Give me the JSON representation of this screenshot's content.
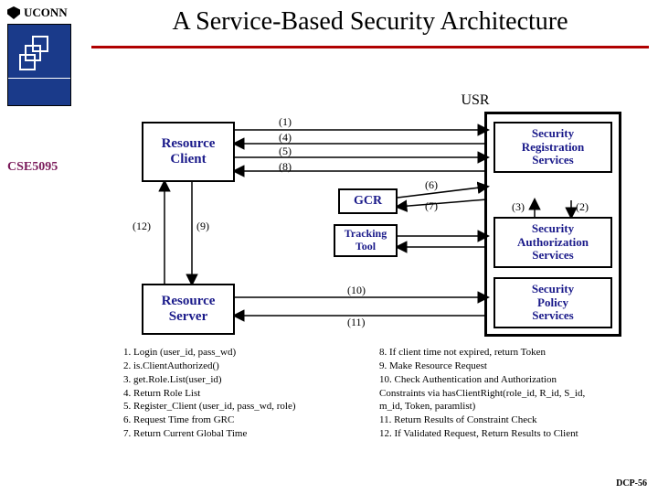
{
  "header": {
    "org": "UCONN",
    "title": "A Service-Based Security Architecture",
    "course": "CSE5095"
  },
  "boxes": {
    "usr": "USR",
    "resource_client": "Resource\nClient",
    "gcr": "GCR",
    "tracking_tool": "Tracking\nTool",
    "resource_server": "Resource\nServer",
    "sec_reg": "Security\nRegistration\nServices",
    "sec_auth": "Security\nAuthorization\nServices",
    "sec_policy": "Security\nPolicy\nServices"
  },
  "edges": {
    "e1": "(1)",
    "e2": "(2)",
    "e3": "(3)",
    "e4": "(4)",
    "e5": "(5)",
    "e6": "(6)",
    "e7": "(7)",
    "e8": "(8)",
    "e9": "(9)",
    "e10": "(10)",
    "e11": "(11)",
    "e12": "(12)"
  },
  "legend_left": [
    "1.  Login (user_id, pass_wd)",
    "2.  is.ClientAuthorized()",
    "3.  get.Role.List(user_id)",
    "4.  Return Role List",
    "5.  Register_Client (user_id, pass_wd, role)",
    "6.  Request Time from GRC",
    "7.  Return Current Global Time"
  ],
  "legend_right": [
    "8.  If client time not expired, return Token",
    "9.  Make Resource Request",
    "10. Check Authentication and Authorization",
    "Constraints via hasClientRight(role_id, R_id, S_id,",
    "                               m_id, Token, paramlist)",
    "11.  Return Results of Constraint Check",
    "12.  If Validated Request, Return Results to Client"
  ],
  "footer": "DCP-56"
}
